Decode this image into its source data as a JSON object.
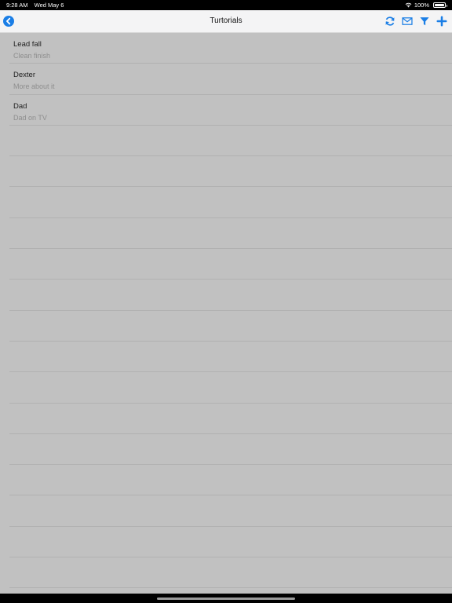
{
  "status_bar": {
    "time": "9:28 AM",
    "date": "Wed May 6",
    "battery": "100%"
  },
  "nav": {
    "title": "Turtorials"
  },
  "colors": {
    "accent": "#1a7ee6",
    "list_background": "#c1c1c1",
    "nav_background": "#f4f4f5"
  },
  "icons": {
    "back": "chevron-left-circle-icon",
    "refresh": "refresh-icon",
    "mail": "envelope-icon",
    "filter": "filter-icon",
    "add": "plus-icon"
  },
  "items": [
    {
      "title": "Lead fall",
      "subtitle": "Clean finish"
    },
    {
      "title": "Dexter",
      "subtitle": "More about it"
    },
    {
      "title": "Dad",
      "subtitle": "Dad on TV"
    }
  ],
  "empty_rows": 15
}
